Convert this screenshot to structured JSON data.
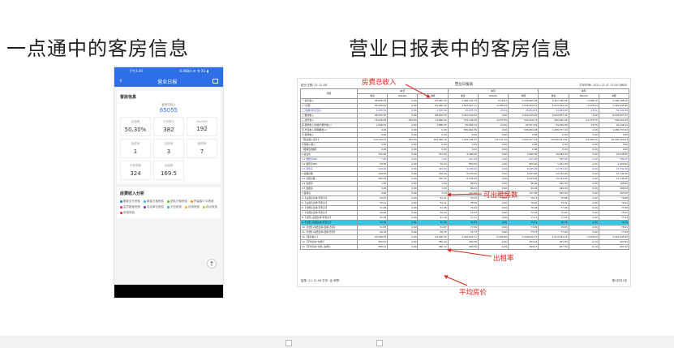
{
  "headings": {
    "left": "一点通中的客房信息",
    "right": "营业日报表中的客房信息"
  },
  "phone": {
    "status_time": "下午3:30",
    "status_right": "0.4KB/s ✉ 令 5G ▮",
    "nav_back": "‹",
    "nav_title": "营业日报",
    "nav_icon": "share-icon",
    "card1": {
      "title": "客房信息",
      "kpi_label": "客房总收入",
      "kpi_value": "65055",
      "cells": [
        {
          "label": "出租率",
          "value": "50.30%"
        },
        {
          "label": "平均房价",
          "value": "382"
        },
        {
          "label": "RevPAR",
          "value": "192"
        },
        {
          "label": "免费房",
          "value": "1"
        },
        {
          "label": "自用房",
          "value": "3"
        },
        {
          "label": "维修房",
          "value": "7"
        },
        {
          "label": "可售房数",
          "value": "324"
        },
        {
          "label": "出租房",
          "value": "169.5"
        }
      ]
    },
    "card2": {
      "title": "房费收入分析",
      "legend": [
        {
          "label": "散客全日房费",
          "color": "#2e6ee8"
        },
        {
          "label": "散客日租房费",
          "color": "#2db7f5"
        },
        {
          "label": "团队日租房费",
          "color": "#52c41a"
        },
        {
          "label": "预留客OTA房费",
          "color": "#fa8c16"
        },
        {
          "label": "会员散客房费",
          "color": "#eb2f96"
        },
        {
          "label": "协议单位房费",
          "color": "#722ed1"
        },
        {
          "label": "长包房费",
          "color": "#13c2c2"
        },
        {
          "label": "自用房费",
          "color": "#faad14"
        },
        {
          "label": "钟点房费",
          "color": "#a0d911"
        },
        {
          "label": "其他房费",
          "color": "#f5222d"
        }
      ],
      "fab": "↑"
    }
  },
  "report": {
    "title": "营业日报表",
    "meta_left": "统计日期: 21-12-06",
    "meta_right": "打印时间: 2021-12-07 13:30 DBBS",
    "col_groups": [
      "项目",
      "本日",
      "本月",
      "本年"
    ],
    "col_sub": [
      "发生",
      "Rebate",
      "净额",
      "发生",
      "Rebate",
      "净额",
      "发生",
      "Rebate",
      "净额"
    ],
    "rows": [
      {
        "name": "一.客房收入",
        "v": [
          "65,055.50",
          "0.00",
          "65,055.50",
          "2,566,197.15",
          "-5,518.2",
          "2,545,665.56",
          "5,467,786.89",
          "-2,558.20",
          "5,465,198.56"
        ],
        "c": ""
      },
      {
        "name": "(一)房费",
        "v": [
          "63,290.50",
          "0.00",
          "63,290.50",
          "2,522,021.11",
          "-2,495.63",
          "2,516,526.51",
          "5,413,524.29",
          "-2,578.64",
          "5,410,945.95"
        ],
        "c": ""
      },
      {
        "name": "(二)加收(含全日房)",
        "v": [
          "1,505.50",
          "0.00",
          "1,505.50",
          "25,675.33",
          "-23.61",
          "25,654.47",
          "54,264.69",
          "-23.61",
          "54,241.69"
        ],
        "c": "bl"
      },
      {
        "name": "二.餐饮收入",
        "v": [
          "86,505.50",
          "0.00",
          "86,505.50",
          "2,922,540.42",
          "0.00",
          "2,922,540.42",
          "8,529,857.41",
          "0.00",
          "8,529,857.41"
        ],
        "c": ""
      },
      {
        "name": "三.康乐收入",
        "v": [
          "15,226.00",
          "-790.00",
          "14,466.00",
          "352,199.29",
          "-9,972.50",
          "342,226.79",
          "560,465.09",
          "-11,272.50",
          "549,220.29"
        ],
        "c": ""
      },
      {
        "name": "四.其他收入(含客户服务收入)",
        "v": [
          "1,586.55",
          "0.00",
          "1,586.55",
          "92,580.74",
          "-23.55",
          "92,557.19",
          "94,250.08",
          "-23.55",
          "94,246.54"
        ],
        "c": ""
      },
      {
        "name": "五.外包收入(再购租收入)",
        "v": [
          "0.00",
          "0.00",
          "0.00",
          "565,664.95",
          "0.00",
          "565,664.95",
          "1,289,757.00",
          "0.00",
          "1,289,757.00"
        ],
        "c": ""
      },
      {
        "name": "六.其他收入",
        "v": [
          "0.00",
          "0.00",
          "0.00",
          "0.00",
          "0.00",
          "0.00",
          "0.00",
          "0.00",
          "0.00"
        ],
        "c": ""
      },
      {
        "name": "【营业收入合计】",
        "v": [
          "170,136.15",
          "-790.00",
          "169,346.15",
          "7,034,169.47",
          "-15,511.76",
          "7,021,057.16",
          "16,240,423.62",
          "-13,994.45",
          "16,226,429.03"
        ],
        "c": ""
      },
      {
        "name": "全部收入收入",
        "v": [
          "0.00",
          "0.00",
          "0.00",
          "0.00",
          "0.00",
          "0.00",
          "0.00",
          "0.00",
          "0.00"
        ],
        "c": ""
      },
      {
        "name": "【夜审应收额】",
        "v": [
          "0.00",
          "0.00",
          "0.00",
          "0.00",
          "0.00",
          "0.00",
          "0.00",
          "0.00",
          "0.00"
        ],
        "c": ""
      },
      {
        "name": "1.营业房",
        "v": [
          "331.00",
          "0.00",
          "331.00",
          "9,486.00",
          "0.00",
          "9,486.00",
          "18,536.00",
          "0.00",
          "18,536.00"
        ],
        "c": ""
      },
      {
        "name": "1.1 维修房000",
        "v": [
          "7.00",
          "0.00",
          "7.00",
          "411.00",
          "0.00",
          "411.00",
          "784.00",
          "0.00",
          "784.00"
        ],
        "c": "bl"
      },
      {
        "name": "1.2 锁定房000",
        "v": [
          "50.00",
          "0.00",
          "50.00",
          "859.00",
          "0.00",
          "859.00",
          "1,432.00",
          "0.00",
          "1,432.00"
        ],
        "c": ""
      },
      {
        "name": "1.3 可售房",
        "v": [
          "324.00",
          "0.00",
          "324.00",
          "9,195.00",
          "0.00",
          "9,195.00",
          "17,752.00",
          "0.00",
          "17,752.00"
        ],
        "c": "bl"
      },
      {
        "name": "2.出租房数",
        "v": [
          "169.50",
          "0.00",
          "169.50",
          "6,233.00",
          "0.00",
          "6,233.00",
          "13,744.00",
          "0.00",
          "13,744.00"
        ],
        "c": ""
      },
      {
        "name": "2.1 付费房数",
        "v": [
          "165.50",
          "0.00",
          "165.50",
          "6,233.00",
          "0.00",
          "6,233.00",
          "13,744.00",
          "0.00",
          "13,744.00"
        ],
        "c": ""
      },
      {
        "name": "2.2 免费房",
        "v": [
          "1.00",
          "0.00",
          "1.00",
          "98.00",
          "0.00",
          "98.00",
          "195.00",
          "0.00",
          "195.00"
        ],
        "c": ""
      },
      {
        "name": "2.3 自用房",
        "v": [
          "3.00",
          "0.00",
          "3.00",
          "94.00",
          "0.00",
          "94.00",
          "169.00",
          "0.00",
          "169.00"
        ],
        "c": ""
      },
      {
        "name": "3.自用房",
        "v": [
          "4.00",
          "0.00",
          "4.00",
          "121.00",
          "0.00",
          "121.00",
          "293.00",
          "0.00",
          "293.00"
        ],
        "c": ""
      },
      {
        "name": "4.【占用房比率(可售房)】",
        "v": [
          "52.31",
          "0.00",
          "52.31",
          "78.13",
          "0.00",
          "78.13",
          "79.68",
          "0.00",
          "79.68"
        ],
        "c": ""
      },
      {
        "name": "5.【占用房比率(可售房)】",
        "v": [
          "53.21",
          "0.00",
          "53.21",
          "78.40",
          "0.00",
          "78.40",
          "79.42",
          "0.00",
          "79.42"
        ],
        "c": ""
      },
      {
        "name": "6.【付费房比率(可售房)】",
        "v": [
          "51.08",
          "0.00",
          "51.08",
          "76.06",
          "0.00",
          "76.06",
          "77.68",
          "0.00",
          "77.68"
        ],
        "c": ""
      },
      {
        "name": "7.【付费房比率(可售房)】",
        "v": [
          "50.00",
          "0.00",
          "50.00",
          "72.43",
          "0.00",
          "72.43",
          "75.01",
          "0.00",
          "75.01"
        ],
        "c": ""
      },
      {
        "name": "8.【付费+免费比率(可售房)】",
        "v": [
          "51.39",
          "0.00",
          "51.39",
          "77.11",
          "0.00",
          "77.11",
          "77.63",
          "0.00",
          "77.63"
        ],
        "c": ""
      },
      {
        "name": "9.【付费+免费比率(可售房)】",
        "v": [
          "50.30",
          "0.00",
          "50.30",
          "75.42",
          "0.00",
          "75.42",
          "76.26",
          "0.00",
          "76.26"
        ],
        "c": "hl"
      },
      {
        "name": "10.【付费+免费比率-自用-合同】",
        "v": [
          "51.87",
          "0.00",
          "51.87",
          "77.95",
          "0.00",
          "77.95",
          "78.93",
          "0.00",
          "78.93"
        ],
        "c": ""
      },
      {
        "name": "11.【付费+免费比率-自用-合同】",
        "v": [
          "50.76",
          "0.00",
          "50.76",
          "75.73",
          "0.00",
          "75.73",
          "77.09",
          "0.00",
          "77.09"
        ],
        "c": ""
      },
      {
        "name": "12.【客房收入】",
        "v": [
          "63,290.50",
          "0.00",
          "63,290.50",
          "2,520,522.11",
          "-2,495.60",
          "2,518,026.51",
          "5,413,524.29",
          "-2,578.64",
          "5,410,945.95"
        ],
        "c": ""
      },
      {
        "name": "13.【平均房价(付费)】",
        "v": [
          "382.42",
          "0.00",
          "382.42",
          "404.58",
          "-0.40",
          "404.18",
          "407.83",
          "-0.19",
          "407.64"
        ],
        "c": ""
      },
      {
        "name": "14.【平均房价(付费+免费)】",
        "v": [
          "380.12",
          "0.00",
          "380.12",
          "399.56",
          "-0.39",
          "399.17",
          "407.59",
          "-0.19",
          "407.40"
        ],
        "c": ""
      }
    ],
    "footer_left": "复核: 21-12-06          打印: 会 审夢",
    "footer_right": "第1页共1页"
  },
  "annotations": {
    "revenue": "房费总收入",
    "rooms": "可出租房数",
    "occupancy": "出租率",
    "avg_price": "平均房价"
  }
}
